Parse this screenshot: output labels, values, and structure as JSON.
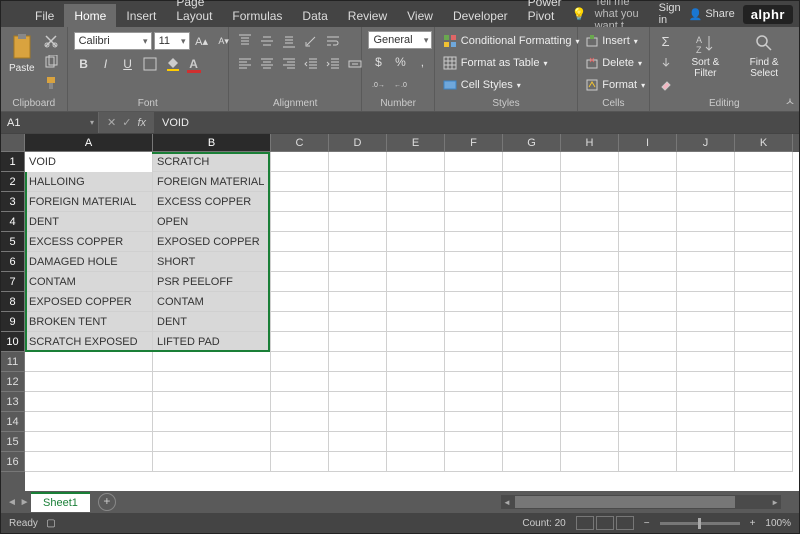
{
  "logo": "alphr",
  "titlebar": {
    "tellme": "Tell me what you want t",
    "signin": "Sign in",
    "share": "Share"
  },
  "tabs": [
    "File",
    "Home",
    "Insert",
    "Page Layout",
    "Formulas",
    "Data",
    "Review",
    "View",
    "Developer",
    "Power Pivot"
  ],
  "active_tab": "Home",
  "ribbon": {
    "clipboard": {
      "paste": "Paste",
      "label": "Clipboard"
    },
    "font": {
      "name": "Calibri",
      "size": "11",
      "label": "Font"
    },
    "alignment": {
      "label": "Alignment"
    },
    "number": {
      "format": "General",
      "label": "Number"
    },
    "styles": {
      "cond": "Conditional Formatting",
      "fat": "Format as Table",
      "cell": "Cell Styles",
      "label": "Styles"
    },
    "cells": {
      "insert": "Insert",
      "delete": "Delete",
      "format": "Format",
      "label": "Cells"
    },
    "editing": {
      "sort": "Sort & Filter",
      "find": "Find & Select",
      "label": "Editing"
    }
  },
  "namebox": "A1",
  "formula": "VOID",
  "columns": [
    "A",
    "B",
    "C",
    "D",
    "E",
    "F",
    "G",
    "H",
    "I",
    "J",
    "K"
  ],
  "rows_shown": 16,
  "selected_rows": 10,
  "data": {
    "A": [
      "VOID",
      "HALLOING",
      "FOREIGN MATERIAL",
      "DENT",
      "EXCESS COPPER",
      "DAMAGED HOLE",
      "CONTAM",
      "EXPOSED COPPER",
      "BROKEN TENT",
      "SCRATCH EXPOSED"
    ],
    "B": [
      "SCRATCH",
      "FOREIGN MATERIAL",
      "EXCESS COPPER",
      "OPEN",
      "EXPOSED COPPER",
      "SHORT",
      "PSR PEELOFF",
      "CONTAM",
      "DENT",
      "LIFTED PAD"
    ]
  },
  "sheet": "Sheet1",
  "status": {
    "ready": "Ready",
    "count_label": "Count:",
    "count": "20",
    "zoom": "100%"
  },
  "symbols": {
    "percent": "%",
    "comma": ",",
    "dollar": "$",
    "dec_inc": ".0 .00",
    "dec_dec": ".00 .0"
  }
}
